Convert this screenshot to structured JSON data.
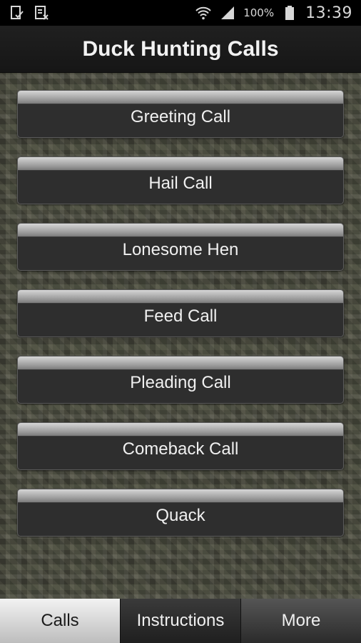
{
  "status_bar": {
    "icons_left": [
      "download-done-icon",
      "contacts-icon"
    ],
    "battery_percent": "100%",
    "time": "13:39"
  },
  "header": {
    "title": "Duck Hunting Calls"
  },
  "calls": [
    {
      "label": "Greeting Call"
    },
    {
      "label": "Hail Call"
    },
    {
      "label": "Lonesome Hen"
    },
    {
      "label": "Feed Call"
    },
    {
      "label": "Pleading Call"
    },
    {
      "label": "Comeback Call"
    },
    {
      "label": "Quack"
    }
  ],
  "tabs": [
    {
      "label": "Calls",
      "active": true
    },
    {
      "label": "Instructions",
      "active": false
    },
    {
      "label": "More",
      "active": false
    }
  ],
  "colors": {
    "title_bar": "#1c1c1c",
    "button_bg": "#2e2e2e",
    "active_tab": "#e6e6e6"
  }
}
